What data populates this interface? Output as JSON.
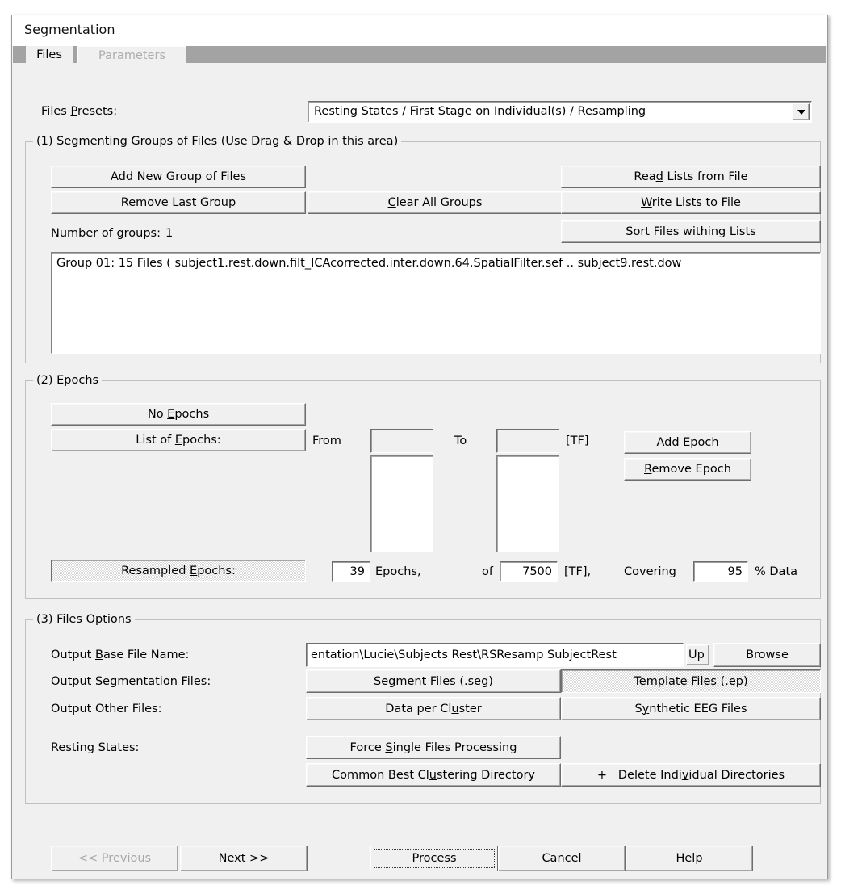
{
  "window": {
    "title": "Segmentation"
  },
  "tabs": [
    {
      "label": "Files",
      "state": "active"
    },
    {
      "label": "Parameters",
      "state": "disabled"
    }
  ],
  "presets": {
    "label": "Files Presets:",
    "label_pre": "Files ",
    "label_accel": "P",
    "label_post": "resets:",
    "value": "Resting States  /  First Stage on Individual(s)  /  Resampling",
    "caret_icon": "chevron-down-icon"
  },
  "section1": {
    "title": "(1) Segmenting Groups of Files   (Use Drag & Drop in this area)",
    "buttons": {
      "add_new_group": {
        "pre": "Add New Group of Files",
        "accel": "",
        "post": ""
      },
      "remove_last_group": {
        "pre": "Remove Last Group",
        "accel": "",
        "post": ""
      },
      "clear_all_groups": {
        "pre": "",
        "accel": "C",
        "post": "lear All Groups"
      },
      "read_lists": {
        "pre": "Rea",
        "accel": "d",
        "post": " Lists from File"
      },
      "write_lists": {
        "pre": "",
        "accel": "W",
        "post": "rite Lists to File"
      },
      "sort_files": {
        "pre": "Sort Files withing Lists",
        "accel": "",
        "post": ""
      }
    },
    "number_of_groups_label": "Number of groups:",
    "number_of_groups_value": "1",
    "group_list": [
      "Group 01:  15 Files  ( subject1.rest.down.filt_ICAcorrected.inter.down.64.SpatialFilter.sef .. subject9.rest.dow"
    ]
  },
  "section2": {
    "title": "(2) Epochs",
    "no_epochs": {
      "pre": "No ",
      "accel": "E",
      "post": "pochs"
    },
    "list_of_epochs": {
      "pre": "List of ",
      "accel": "E",
      "post": "pochs:"
    },
    "from_label": "From",
    "to_label": "To",
    "tf_label": "[TF]",
    "from_value": "",
    "to_value": "",
    "add_epoch": {
      "pre": "A",
      "accel": "d",
      "post": "d Epoch"
    },
    "remove_epoch": {
      "pre": "",
      "accel": "R",
      "post": "emove Epoch"
    },
    "resampled_epochs": {
      "pre": "Resampled ",
      "accel": "E",
      "post": "pochs:"
    },
    "epochs_count": "39",
    "epochs_word": "Epochs,",
    "of_word": "of",
    "tf_total": "7500",
    "tf_unit_label": "[TF],",
    "covering_label": "Covering",
    "covering_value": "95",
    "percent_label": "% Data"
  },
  "section3": {
    "title": "(3) Files Options",
    "output_base_label": {
      "pre": "Output ",
      "accel": "B",
      "post": "ase File Name:"
    },
    "output_base_value": "еntation\\Lucie\\Subjects Rest\\RSResamp SubjectRest",
    "up_button": "Up",
    "browse_button": "Browse",
    "output_seg_label": "Output Segmentation Files:",
    "segment_files": {
      "pre": "Se",
      "accel": "g",
      "post": "ment Files (.seg)"
    },
    "template_files": {
      "pre": "Te",
      "accel": "m",
      "post": "plate Files (.ep)"
    },
    "output_other_label": "Output Other Files:",
    "data_per_cluster": {
      "pre": "Data per Cl",
      "accel": "u",
      "post": "ster"
    },
    "synthetic_eeg": {
      "pre": "S",
      "accel": "y",
      "post": "nthetic EEG Files"
    },
    "resting_states_label": "Resting States:",
    "force_single": {
      "pre": "Force ",
      "accel": "S",
      "post": "ingle Files Processing"
    },
    "common_best": {
      "pre": "Common Best Cl",
      "accel": "u",
      "post": "stering Directory"
    },
    "plus_sign": "+",
    "delete_individual": {
      "pre": "Delete Indi",
      "accel": "v",
      "post": "idual Directories"
    }
  },
  "footer": {
    "previous": {
      "pre": "<",
      "accel": "<",
      "post": "  Previous"
    },
    "next": {
      "pre": "Next  ",
      "accel": ">",
      "post": ">"
    },
    "process": {
      "pre": "Pro",
      "accel": "c",
      "post": "ess"
    },
    "cancel": "Cancel",
    "help": "Help"
  }
}
